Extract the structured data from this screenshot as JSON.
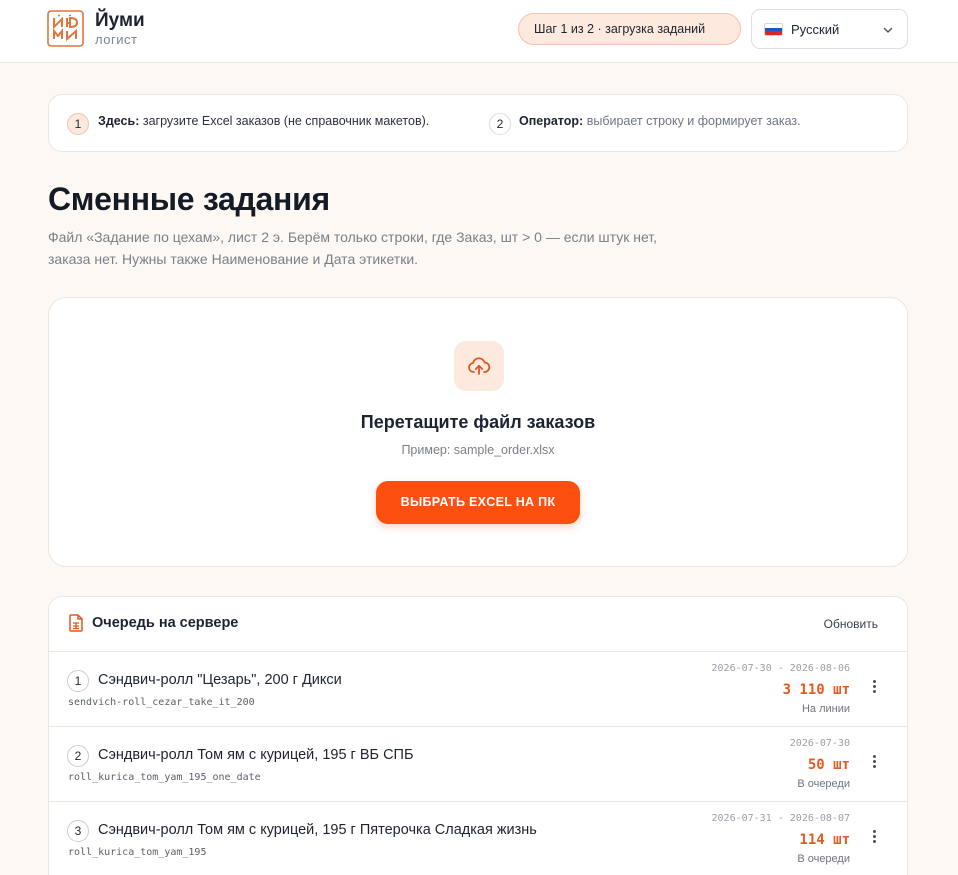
{
  "header": {
    "brand_name": "Йуми",
    "brand_sub": "логист",
    "step": "Шаг 1 из 2 · загрузка заданий",
    "language": "Русский"
  },
  "info": [
    {
      "num": "1",
      "bold": "Здесь:",
      "text": "загрузите Excel заказов (не справочник макетов)."
    },
    {
      "num": "2",
      "bold": "Оператор:",
      "text": "выбирает строку и формирует заказ."
    }
  ],
  "page": {
    "title": "Сменные задания",
    "description": "Файл «Задание по цехам», лист 2 э. Берём только строки, где Заказ, шт > 0 — если штук нет, заказа нет. Нужны также Наименование и Дата этикетки."
  },
  "upload": {
    "title": "Перетащите файл заказов",
    "hint": "Пример: sample_order.xlsx",
    "button": "ВЫБРАТЬ EXCEL НА ПК"
  },
  "queue": {
    "title": "Очередь на сервере",
    "refresh": "Обновить",
    "rows": [
      {
        "num": "1",
        "name": "Сэндвич-ролл \"Цезарь\", 200 г Дикси",
        "code": "sendvich-roll_cezar_take_it_200",
        "date": "2026-07-30 - 2026-08-06",
        "qty": "3 110 шт",
        "status": "На линии"
      },
      {
        "num": "2",
        "name": "Сэндвич-ролл Том ям с курицей, 195 г ВБ СПБ",
        "code": "roll_kurica_tom_yam_195_one_date",
        "date": "2026-07-30",
        "qty": "50 шт",
        "status": "В очереди"
      },
      {
        "num": "3",
        "name": "Сэндвич-ролл Том ям с курицей, 195 г Пятерочка Сладкая жизнь",
        "code": "roll_kurica_tom_yam_195",
        "date": "2026-07-31 - 2026-08-07",
        "qty": "114 шт",
        "status": "В очереди"
      }
    ]
  },
  "icons": {
    "logo": "yumi-logo-icon",
    "flag": "russia-flag-icon",
    "dropdown": "chevron-down-icon",
    "upload": "cloud-upload-icon",
    "queue": "spreadsheet-file-icon",
    "row_menu": "more-vertical-icon"
  },
  "colors": {
    "accent": "#fc4f10",
    "accent_soft": "#fde9dd",
    "quantity": "#e55a1f",
    "background": "#fdf8f3"
  }
}
